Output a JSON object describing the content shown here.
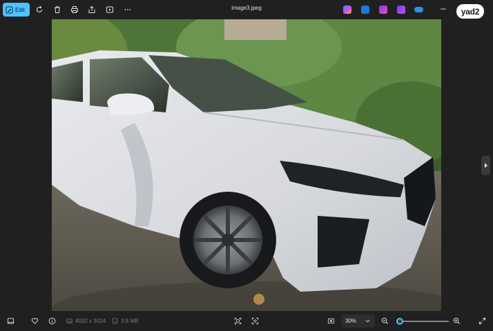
{
  "toolbar": {
    "edit_label": "Edit",
    "icons": [
      "pen-icon",
      "rotate-icon",
      "delete-icon",
      "print-icon",
      "share-icon",
      "slideshow-icon",
      "more-icon"
    ],
    "accent": "#4cc2ff"
  },
  "window": {
    "title": "image3.jpeg",
    "brand": "yad2",
    "apps": [
      "copilot-icon",
      "clipchamp-icon",
      "designer-icon",
      "video-editor-icon",
      "onedrive-icon"
    ]
  },
  "status": {
    "dimensions": "4032 x 3024",
    "file_size": "3.8 MB"
  },
  "zoom": {
    "value": "30%",
    "level": 0.06
  }
}
